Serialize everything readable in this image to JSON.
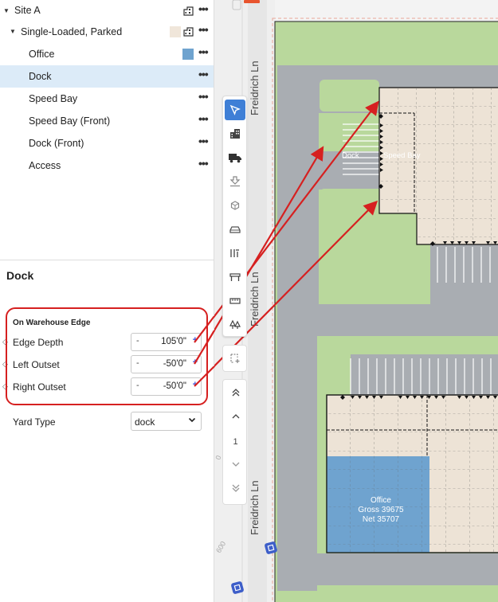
{
  "tree": {
    "site": "Site A",
    "building": "Single-Loaded, Parked",
    "items": [
      {
        "label": "Office",
        "color": "#6fa3cf"
      },
      {
        "label": "Dock",
        "selected": true
      },
      {
        "label": "Speed Bay"
      },
      {
        "label": "Speed Bay (Front)"
      },
      {
        "label": "Dock (Front)"
      },
      {
        "label": "Access"
      }
    ],
    "more_label": "•••",
    "building_swatch": "#f0e6da"
  },
  "properties": {
    "title": "Dock",
    "section": "On Warehouse Edge",
    "fields": [
      {
        "label": "Edge Depth",
        "value": "105'0\"",
        "minus": "-",
        "plus": "+"
      },
      {
        "label": "Left Outset",
        "value": "-50'0\"",
        "minus": "-",
        "plus": "+"
      },
      {
        "label": "Right Outset",
        "value": "-50'0\"",
        "minus": "-",
        "plus": "+"
      }
    ],
    "yard_type_label": "Yard Type",
    "yard_type_value": "dock"
  },
  "map": {
    "street": "Freidrich Ln",
    "dock_label": "Dock",
    "speed_bay_label": "Speed Bay",
    "office_label": "Office",
    "office_gross": "Gross 39675",
    "office_net": "Net 35707",
    "contour_a": "0",
    "contour_b": "600"
  },
  "pager": {
    "page": "1"
  },
  "colors": {
    "accent": "#3f7fd6",
    "selected_row": "#dcebf8",
    "annotation": "#d62020",
    "grass": "#b9d89c",
    "pavement": "#a9adb2",
    "building": "#ede3d6",
    "office": "#6fa3cf"
  }
}
